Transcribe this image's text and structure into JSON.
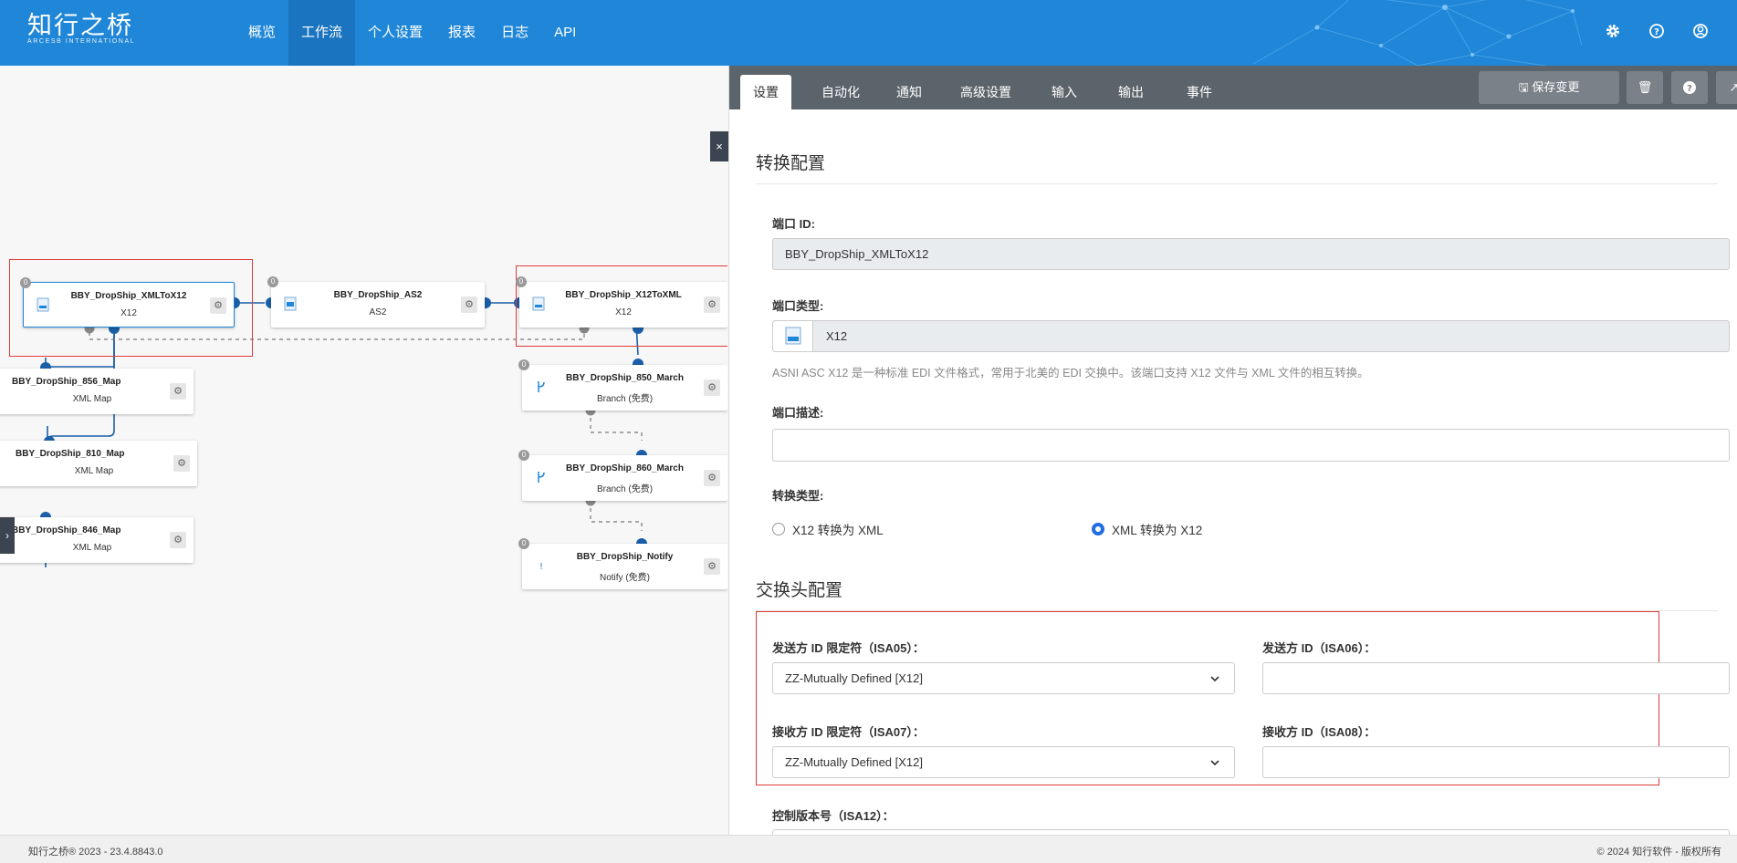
{
  "brand": {
    "name_cn": "知行之桥",
    "name_en": "ARCESB INTERNATIONAL"
  },
  "nav": [
    {
      "label": "概览",
      "active": false
    },
    {
      "label": "工作流",
      "active": true
    },
    {
      "label": "个人设置",
      "active": false
    },
    {
      "label": "报表",
      "active": false
    },
    {
      "label": "日志",
      "active": false
    },
    {
      "label": "API",
      "active": false
    }
  ],
  "top_icons": [
    "gear-icon",
    "help-icon",
    "user-icon"
  ],
  "canvas": {
    "nodes": [
      {
        "id": "xmltox12",
        "title": "BBY_DropShip_XMLToX12",
        "subtitle": "X12",
        "badge": "0",
        "selected": true
      },
      {
        "id": "as2",
        "title": "BBY_DropShip_AS2",
        "subtitle": "AS2",
        "badge": "0"
      },
      {
        "id": "x12toxml",
        "title": "BBY_DropShip_X12ToXML",
        "subtitle": "X12",
        "badge": "0"
      },
      {
        "id": "map856",
        "title": "BBY_DropShip_856_Map",
        "subtitle": "XML Map"
      },
      {
        "id": "map810",
        "title": "BBY_DropShip_810_Map",
        "subtitle": "XML Map"
      },
      {
        "id": "map846",
        "title": "BBY_DropShip_846_Map",
        "subtitle": "XML Map"
      },
      {
        "id": "march850",
        "title": "BBY_DropShip_850_March",
        "subtitle": "Branch (免费)",
        "badge": "0"
      },
      {
        "id": "march860",
        "title": "BBY_DropShip_860_March",
        "subtitle": "Branch (免费)",
        "badge": "0"
      },
      {
        "id": "notify",
        "title": "BBY_DropShip_Notify",
        "subtitle": "Notify (免费)",
        "badge": "0"
      }
    ],
    "close_label": "×",
    "expand_label": "›"
  },
  "panel": {
    "tabs": [
      "设置",
      "自动化",
      "通知",
      "高级设置",
      "输入",
      "输出",
      "事件"
    ],
    "active_tab": "设置",
    "save_label": "保存变更",
    "section_convert": "转换配置",
    "port_id_label": "端口 ID:",
    "port_id_value": "BBY_DropShip_XMLToX12",
    "port_type_label": "端口类型:",
    "port_type_value": "X12",
    "port_type_help": "ASNI ASC X12 是一种标准 EDI 文件格式，常用于北美的 EDI 交换中。该端口支持 X12 文件与 XML 文件的相互转换。",
    "port_desc_label": "端口描述:",
    "port_desc_value": "",
    "conv_type_label": "转换类型:",
    "conv_opt1": "X12 转换为 XML",
    "conv_opt2": "XML 转换为 X12",
    "conv_selected": 2,
    "section_header": "交换头配置",
    "isa05_label": "发送方 ID 限定符（ISA05）：",
    "isa05_value": "ZZ-Mutually Defined [X12]",
    "isa06_label": "发送方 ID（ISA06）：",
    "isa06_value": "",
    "isa07_label": "接收方 ID 限定符（ISA07）：",
    "isa07_value": "ZZ-Mutually Defined [X12]",
    "isa08_label": "接收方 ID（ISA08）：",
    "isa08_value": "",
    "isa12_label": "控制版本号（ISA12）："
  },
  "footer": {
    "left": "知行之桥® 2023 - 23.4.8843.0",
    "right": "© 2024 知行软件 - 版权所有"
  },
  "colors": {
    "header": "#1f86d8",
    "tabbar": "#5c646b",
    "highlight": "#e03a3a",
    "accent": "#1f6fe0"
  }
}
